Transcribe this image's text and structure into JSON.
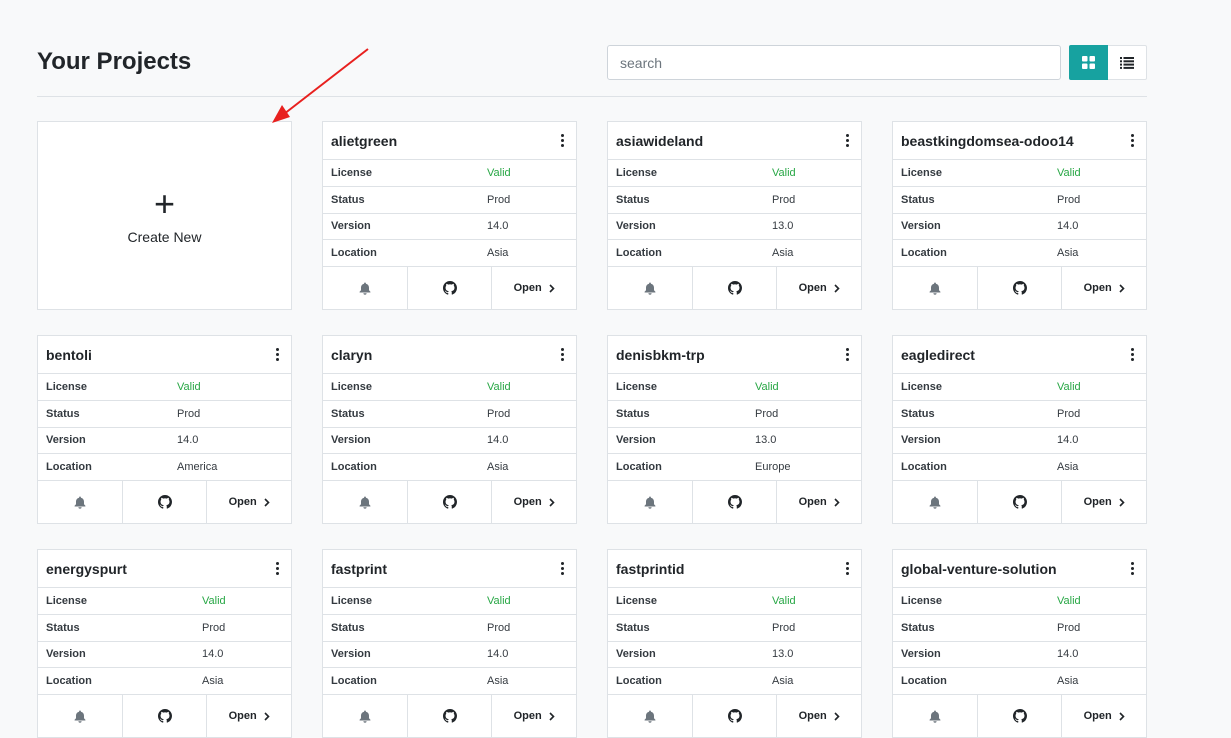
{
  "header": {
    "title": "Your Projects",
    "search_placeholder": "search",
    "search_value": "",
    "view_modes": [
      "grid",
      "list"
    ],
    "active_view": "grid",
    "accent_color": "#17a2a0"
  },
  "create_card": {
    "icon": "+",
    "label": "Create New"
  },
  "labels": {
    "license": "License",
    "status": "Status",
    "version": "Version",
    "location": "Location",
    "open": "Open"
  },
  "colors": {
    "valid": "#28a745"
  },
  "projects": [
    {
      "name": "alietgreen",
      "license": "Valid",
      "status": "Prod",
      "version": "14.0",
      "location": "Asia"
    },
    {
      "name": "asiawideland",
      "license": "Valid",
      "status": "Prod",
      "version": "13.0",
      "location": "Asia"
    },
    {
      "name": "beastkingdomsea-odoo14",
      "license": "Valid",
      "status": "Prod",
      "version": "14.0",
      "location": "Asia"
    },
    {
      "name": "bentoli",
      "license": "Valid",
      "status": "Prod",
      "version": "14.0",
      "location": "America"
    },
    {
      "name": "claryn",
      "license": "Valid",
      "status": "Prod",
      "version": "14.0",
      "location": "Asia"
    },
    {
      "name": "denisbkm-trp",
      "license": "Valid",
      "status": "Prod",
      "version": "13.0",
      "location": "Europe"
    },
    {
      "name": "eagledirect",
      "license": "Valid",
      "status": "Prod",
      "version": "14.0",
      "location": "Asia"
    },
    {
      "name": "energyspurt",
      "license": "Valid",
      "status": "Prod",
      "version": "14.0",
      "location": "Asia"
    },
    {
      "name": "fastprint",
      "license": "Valid",
      "status": "Prod",
      "version": "14.0",
      "location": "Asia"
    },
    {
      "name": "fastprintid",
      "license": "Valid",
      "status": "Prod",
      "version": "13.0",
      "location": "Asia"
    },
    {
      "name": "global-venture-solution",
      "license": "Valid",
      "status": "Prod",
      "version": "14.0",
      "location": "Asia"
    }
  ]
}
